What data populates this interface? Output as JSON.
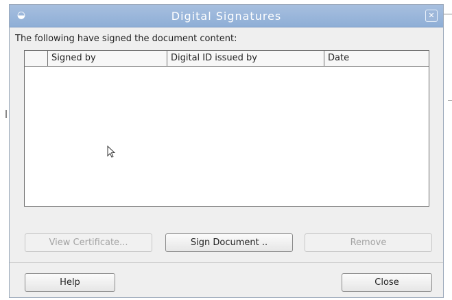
{
  "dialog": {
    "title": "Digital Signatures",
    "close_symbol": "✕",
    "app_symbol": "◒"
  },
  "intro_text": "The following have signed the document content:",
  "table": {
    "columns": [
      "",
      "Signed by",
      "Digital ID issued by",
      "Date"
    ],
    "rows": []
  },
  "buttons": {
    "view_certificate": "View Certificate...",
    "sign_document": "Sign Document ..",
    "remove": "Remove",
    "help": "Help",
    "close": "Close"
  },
  "icons": {
    "app": "dialog-app-icon",
    "close": "close-icon",
    "cursor": "mouse-pointer-icon"
  }
}
